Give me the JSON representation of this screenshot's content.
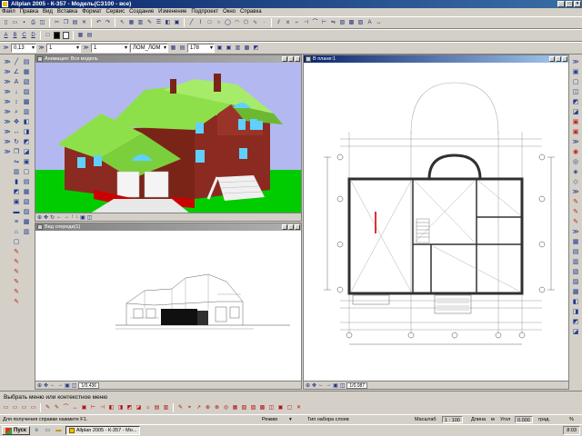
{
  "window": {
    "title": "Allplan 2005 - К-357 - Модель(СЗ100 - все)"
  },
  "menu": [
    "Файл",
    "Правка",
    "Вид",
    "Вставка",
    "Формат",
    "Сервис",
    "Создание",
    "Изменение",
    "Подпроект",
    "Окно",
    "Справка"
  ],
  "format_bar": {
    "pen_thickness": "0,13",
    "line_type": "1",
    "color_index": "1",
    "layer": "ЛОМ_ЛОМ",
    "scale_value": "178"
  },
  "windows": {
    "animation": {
      "title": "Анимация: Вся модель",
      "zoom": ""
    },
    "section": {
      "title": "Вид спереди(1)",
      "zoom": "1/0.436"
    },
    "plan": {
      "title": "В плане:1",
      "zoom": "1/0.087"
    }
  },
  "prompt": {
    "text": "Выбрать меню или контекстное меню"
  },
  "status": {
    "help": "Для получения справки нажмите F1.",
    "mode_label": "Режим",
    "tool_label": "Тип набора слоев",
    "scale_label": "Масштаб",
    "scale_value": "1 : 100",
    "length_label": "Длина",
    "length_unit": "м",
    "angle_label": "Угол",
    "angle_value": "0.000",
    "grad_label": "град.",
    "percent": "%"
  },
  "taskbar": {
    "start_label": "Пуск",
    "task_label": "Allplan 2005 - К-357 - Мо...",
    "clock": "8:03"
  },
  "colors": {
    "title_active": "#0a246a",
    "roof": "#8ee04a",
    "brick": "#8b2a20",
    "sky": "#b4b8f0",
    "grass": "#00cc00"
  }
}
